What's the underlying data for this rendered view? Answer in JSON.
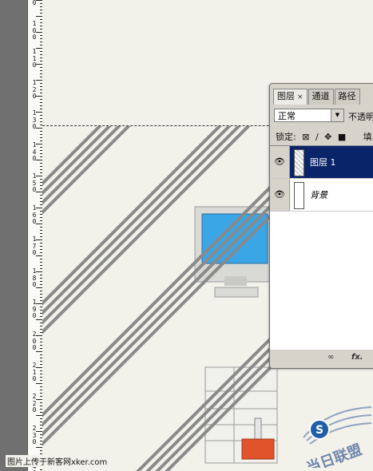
{
  "ruler": {
    "labels": [
      "10",
      "11",
      "12",
      "13",
      "14",
      "15",
      "16",
      "17",
      "18",
      "19",
      "20",
      "21",
      "22",
      "23",
      "24"
    ],
    "partial_top": "0"
  },
  "layers_panel": {
    "tabs": [
      {
        "label": "图层",
        "close": "×"
      },
      {
        "label": "通道"
      },
      {
        "label": "路径"
      }
    ],
    "blend_mode": "正常",
    "opacity_label": "不透明",
    "lock_label": "锁定:",
    "fill_label": "填",
    "layers": [
      {
        "name": "图层 1",
        "selected": true
      },
      {
        "name": "背景",
        "selected": false
      }
    ],
    "bottom_icons": [
      "link-icon",
      "fx-icon"
    ],
    "fx_label": "fx."
  },
  "footer": {
    "credit": "图片上传于新客网xker.com"
  },
  "watermark": {
    "badge": "S",
    "text": "当日联盟"
  },
  "colors": {
    "selection_highlight": "#0a246a",
    "canvas": "#f2f1ea",
    "stripe": "#8a8a8a",
    "monitor_screen": "#3aa6e6",
    "tool_red": "#e1532a"
  }
}
